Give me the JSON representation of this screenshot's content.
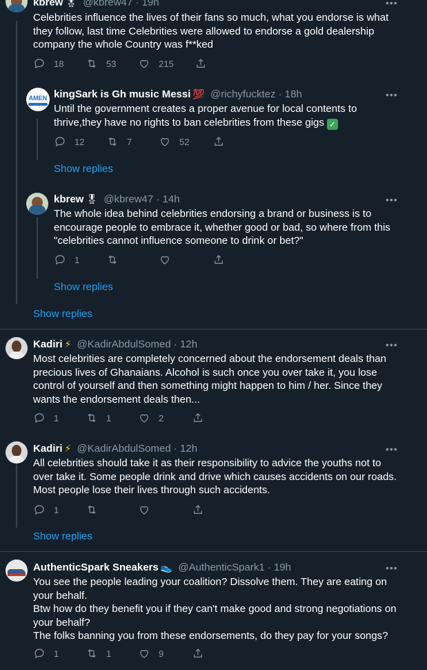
{
  "tweets": [
    {
      "name": "kbrew",
      "badge": "🎖",
      "handle": "@kbrew47",
      "time": "19h",
      "text": "Celebrities influence the lives of their fans so much, what you endorse is what they follow,  last time Celebrities were allowed to endorse a gold dealership company the whole Country was f**ked",
      "replies": "18",
      "retweets": "53",
      "likes": "215"
    },
    {
      "name": "kingSark is Gh music Messi",
      "badge": "💯",
      "handle": "@richyfucktez",
      "time": "18h",
      "avatar_label": "AMEN",
      "text": "Until the government creates a proper avenue for local contents to thrive,they have no rights to ban celebrities from these gigs",
      "text_emoji": "✓",
      "replies": "12",
      "retweets": "7",
      "likes": "52",
      "show_replies": "Show replies"
    },
    {
      "name": "kbrew",
      "badge": "🎖",
      "handle": "@kbrew47",
      "time": "14h",
      "text": "The whole idea behind celebrities endorsing a brand or business is to encourage people  to embrace it, whether good or bad, so where from this \"celebrities  cannot influence someone  to drink or bet?\"",
      "replies": "1",
      "retweets": "",
      "likes": "",
      "show_replies": "Show replies"
    },
    {
      "name": "Kadiri",
      "badge": "⚡",
      "handle": "@KadirAbdulSomed",
      "time": "12h",
      "text": "Most celebrities are completely concerned about the endorsement deals than precious lives of Ghanaians. Alcohol is such once you over take it, you lose control of yourself and then something might happen to him / her. Since they wants the endorsement deals then...",
      "replies": "1",
      "retweets": "1",
      "likes": "2"
    },
    {
      "name": "Kadiri",
      "badge": "⚡",
      "handle": "@KadirAbdulSomed",
      "time": "12h",
      "text": "All celebrities should take it as their responsibility to advice the youths not to over take it. Some people drink and drive which causes accidents on our roads. Most people lose their lives through such accidents.",
      "replies": "1",
      "retweets": "",
      "likes": "",
      "show_replies": "Show replies"
    },
    {
      "name": "AuthenticSpark Sneakers",
      "badge": "👟",
      "handle": "@AuthenticSpark1",
      "time": "19h",
      "text_lines": [
        "You see the people leading your coalition? Dissolve them. They are eating on your behalf.",
        "Btw how do they benefit you if they can't make good and strong negotiations on your behalf?",
        "The folks banning you from these endorsements, do they pay for your songs?"
      ],
      "replies": "1",
      "retweets": "1",
      "likes": "9"
    }
  ],
  "outer_show_replies": "Show replies",
  "dot_sep": "·",
  "more_glyph": "•••",
  "colors": {
    "bg": "#15202b",
    "accent": "#1da1f2",
    "muted": "#8899a6",
    "line": "#38444d"
  }
}
